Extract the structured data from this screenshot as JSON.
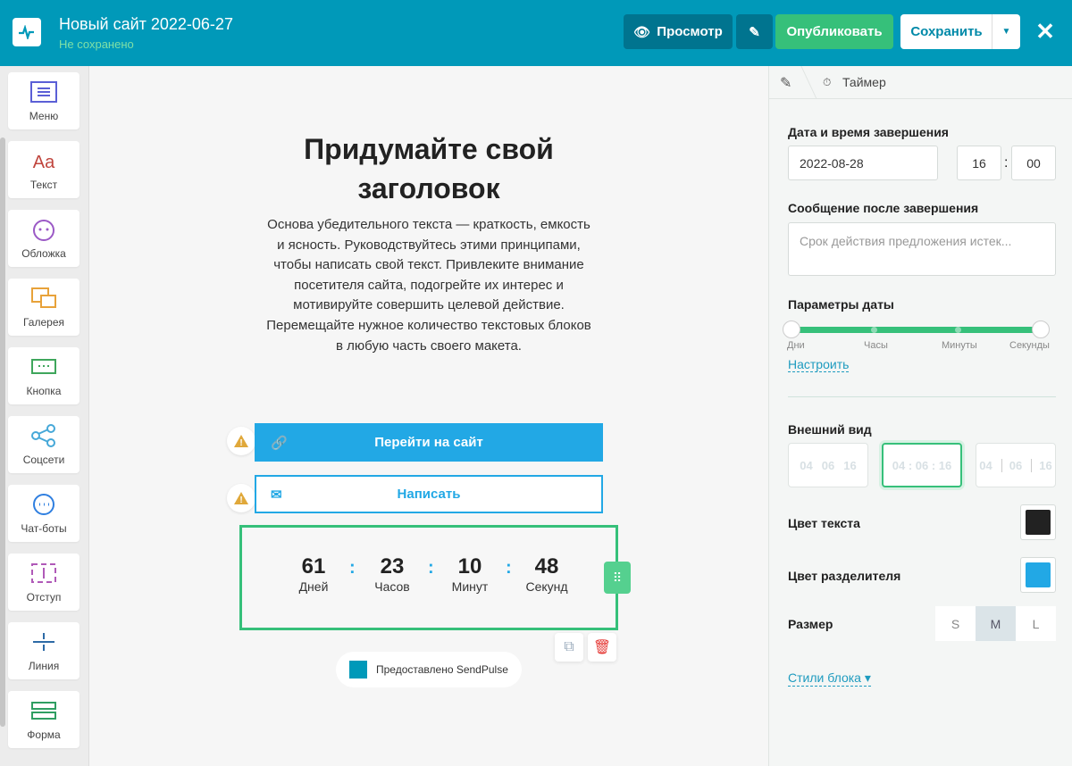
{
  "header": {
    "title": "Новый сайт 2022-06-27",
    "status": "Не сохранено",
    "preview": "Просмотр",
    "publish": "Опубликовать",
    "save": "Сохранить"
  },
  "sidebar": {
    "items": [
      {
        "label": "Меню",
        "icon": "menu-icon"
      },
      {
        "label": "Текст",
        "icon": "text-icon"
      },
      {
        "label": "Обложка",
        "icon": "cover-icon"
      },
      {
        "label": "Галерея",
        "icon": "gallery-icon"
      },
      {
        "label": "Кнопка",
        "icon": "button-icon"
      },
      {
        "label": "Соцсети",
        "icon": "share-icon"
      },
      {
        "label": "Чат-боты",
        "icon": "chat-icon"
      },
      {
        "label": "Отступ",
        "icon": "spacing-icon"
      },
      {
        "label": "Линия",
        "icon": "line-icon"
      },
      {
        "label": "Форма",
        "icon": "form-icon"
      }
    ]
  },
  "canvas": {
    "heading": "Придумайте свой заголовок",
    "paragraph": "Основа убедительного текста — краткость, емкость и ясность. Руководствуйтесь этими принципами, чтобы написать свой текст. Привлеките внимание посетителя сайта, подогрейте их интерес и мотивируйте совершить целевой действие. Перемещайте нужное количество текстовых блоков в любую часть своего макета.",
    "button1": "Перейти на сайт",
    "button2": "Написать",
    "timer": [
      {
        "value": "61",
        "label": "Дней"
      },
      {
        "value": "23",
        "label": "Часов"
      },
      {
        "value": "10",
        "label": "Минут"
      },
      {
        "value": "48",
        "label": "Секунд"
      }
    ],
    "separator": ":",
    "powered": "Предоставлено SendPulse"
  },
  "panel": {
    "breadcrumb": "Таймер",
    "end_label": "Дата и время завершения",
    "date": "2022-08-28",
    "hour": "16",
    "minute": "00",
    "time_sep": ":",
    "message_label": "Сообщение после завершения",
    "message_placeholder": "Срок действия предложения истек...",
    "date_params_label": "Параметры даты",
    "slider": [
      "Дни",
      "Часы",
      "Минуты",
      "Секунды"
    ],
    "slider_range": [
      "Дни",
      "Секунды"
    ],
    "configure": "Настроить",
    "appearance_label": "Внешний вид",
    "views": [
      [
        "04",
        "06",
        "16"
      ],
      [
        "04 : 06 : 16"
      ],
      [
        "04",
        "06",
        "16"
      ]
    ],
    "selected_view": 1,
    "text_color_label": "Цвет текста",
    "text_color": "#222222",
    "sep_color_label": "Цвет разделителя",
    "sep_color": "#22a8e5",
    "size_label": "Размер",
    "sizes": [
      "S",
      "M",
      "L"
    ],
    "selected_size": "M",
    "block_styles": "Стили блока"
  }
}
